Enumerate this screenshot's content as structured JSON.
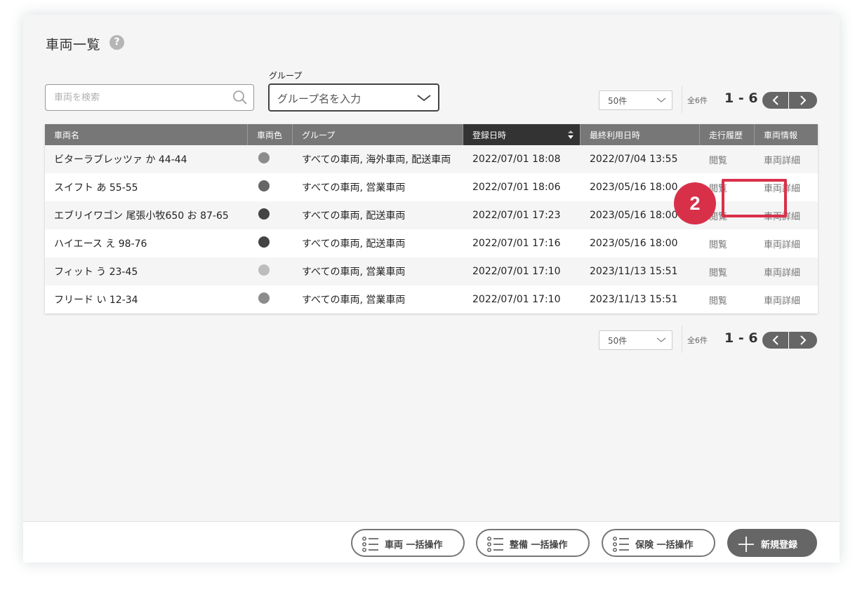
{
  "page": {
    "title": "車両一覧",
    "help_icon": "question-circle-icon",
    "help_glyph": "?"
  },
  "search": {
    "placeholder": "車両を検索",
    "icon": "search-icon"
  },
  "group": {
    "label": "グループ",
    "placeholder": "グループ名を入力"
  },
  "pagination": {
    "per_page": "50件",
    "total": "全6件",
    "range": "1 - 6"
  },
  "table": {
    "headers": [
      "車両名",
      "車両色",
      "グループ",
      "登録日時",
      "最終利用日時",
      "走行履歴",
      "車両情報"
    ],
    "sorted_column": "登録日時",
    "rows": [
      {
        "name": "ビターラブレッツァ か 44-44",
        "color": "#8c8c8c",
        "groups": "すべての車両, 海外車両, 配送車両",
        "registered": "2022/07/01 18:08",
        "last_used": "2022/07/04 13:55",
        "history": "閲覧",
        "info": "車両詳細"
      },
      {
        "name": "スイフト あ 55-55",
        "color": "#666666",
        "groups": "すべての車両, 営業車両",
        "registered": "2022/07/01 18:06",
        "last_used": "2023/05/16 18:00",
        "history": "閲覧",
        "info": "車両詳細"
      },
      {
        "name": "エブリイワゴン 尾張小牧650 お 87-65",
        "color": "#444444",
        "groups": "すべての車両, 配送車両",
        "registered": "2022/07/01 17:23",
        "last_used": "2023/05/16 18:00",
        "history": "閲覧",
        "info": "車両詳細"
      },
      {
        "name": "ハイエース え 98-76",
        "color": "#444444",
        "groups": "すべての車両, 配送車両",
        "registered": "2022/07/01 17:16",
        "last_used": "2023/05/16 18:00",
        "history": "閲覧",
        "info": "車両詳細"
      },
      {
        "name": "フィット う 23-45",
        "color": "#bdbdbd",
        "groups": "すべての車両, 営業車両",
        "registered": "2022/07/01 17:10",
        "last_used": "2023/11/13 15:51",
        "history": "閲覧",
        "info": "車両詳細"
      },
      {
        "name": "フリード い 12-34",
        "color": "#8c8c8c",
        "groups": "すべての車両, 営業車両",
        "registered": "2022/07/01 17:10",
        "last_used": "2023/11/13 15:51",
        "history": "閲覧",
        "info": "車両詳細"
      }
    ]
  },
  "footer": {
    "bulk_vehicle": "車両 一括操作",
    "bulk_maintenance": "整備 一括操作",
    "bulk_insurance": "保険 一括操作",
    "new_registration": "新規登録"
  },
  "annotation": {
    "step": "2",
    "color": "#d9304a"
  }
}
